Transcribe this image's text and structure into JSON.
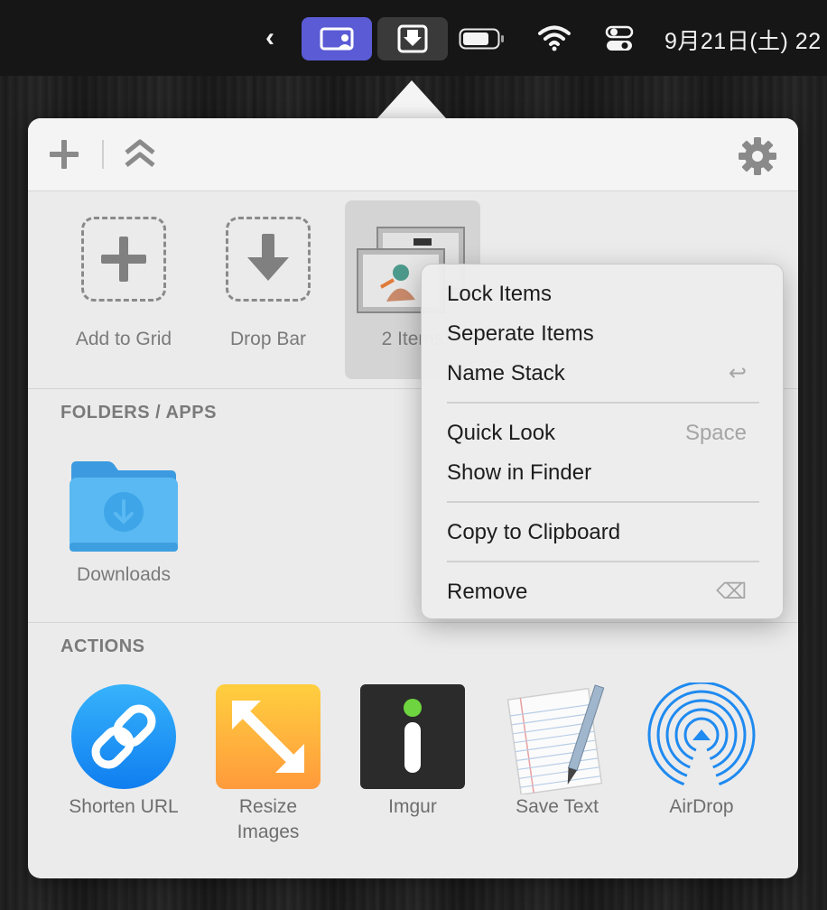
{
  "menubar": {
    "chevron": "‹",
    "clock": "9月21日(土)  22"
  },
  "toolbar": {
    "add_icon": "plus-icon",
    "collapse_icon": "double-chevron-up-icon",
    "settings_icon": "gear-icon"
  },
  "grid": {
    "tiles": [
      {
        "label": "Add to Grid",
        "icon": "plus-icon"
      },
      {
        "label": "Drop Bar",
        "icon": "down-arrow-icon"
      },
      {
        "label": "2 Items",
        "icon": "image-stack"
      }
    ]
  },
  "folders": {
    "header": "FOLDERS / APPS",
    "items": [
      {
        "label": "Downloads",
        "icon": "downloads-folder-icon"
      }
    ]
  },
  "actions": {
    "header": "ACTIONS",
    "items": [
      {
        "label": "Shorten URL",
        "icon": "link-icon"
      },
      {
        "label": "Resize\nImages",
        "label_line1": "Resize",
        "label_line2": "Images",
        "icon": "resize-icon"
      },
      {
        "label": "Imgur",
        "icon": "imgur-icon"
      },
      {
        "label": "Save Text",
        "icon": "notepad-icon"
      },
      {
        "label": "AirDrop",
        "icon": "airdrop-icon"
      }
    ]
  },
  "context_menu": {
    "items": [
      {
        "label": "Lock Items",
        "shortcut": ""
      },
      {
        "label": "Seperate Items",
        "shortcut": ""
      },
      {
        "label": "Name Stack",
        "shortcut": "↩"
      },
      {
        "label": "Quick Look",
        "shortcut": "Space"
      },
      {
        "label": "Show in Finder",
        "shortcut": ""
      },
      {
        "label": "Copy to Clipboard",
        "shortcut": ""
      },
      {
        "label": "Remove",
        "shortcut": "⌫"
      }
    ]
  },
  "colors": {
    "accent_purple": "#5b5bd6",
    "popover_bg": "#ebebeb",
    "folder_blue": "#57b9f3",
    "link_blue": "#1e8ef5",
    "resize_orange": "#ffb43a",
    "imgur_green": "#6ed43f"
  }
}
